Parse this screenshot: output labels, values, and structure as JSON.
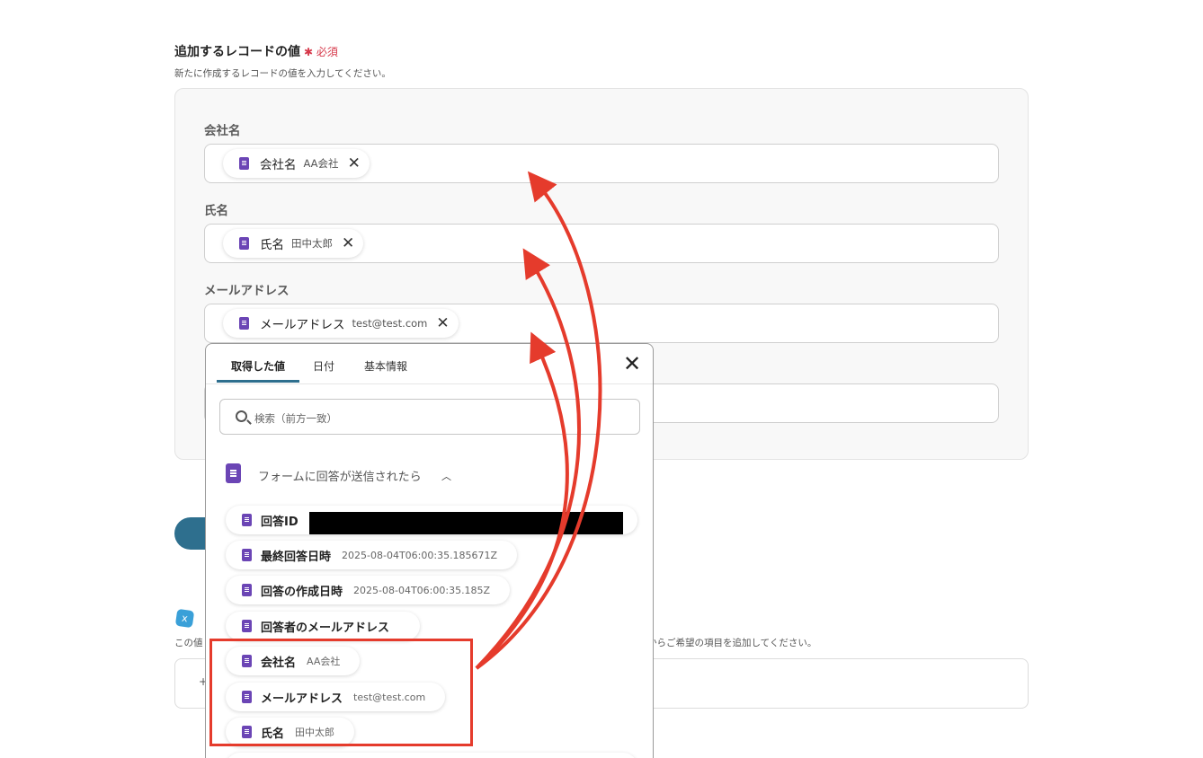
{
  "section": {
    "title": "追加するレコードの値",
    "required_mark": "✱ 必須",
    "description": "新たに作成するレコードの値を入力してください。"
  },
  "fields": [
    {
      "label": "会社名",
      "chip_key": "会社名",
      "chip_value": "AA会社"
    },
    {
      "label": "氏名",
      "chip_key": "氏名",
      "chip_value": "田中太郎"
    },
    {
      "label": "メールアドレス",
      "chip_key": "メールアドレス",
      "chip_value": "test@test.com"
    }
  ],
  "behind": {
    "plus": "+",
    "desc_left": "この値",
    "desc_right": "からご希望の項目を追加してください。"
  },
  "popup": {
    "tabs": [
      "取得した値",
      "日付",
      "基本情報"
    ],
    "active_tab": "取得した値",
    "search_placeholder": "検索（前方一致）",
    "group_title": "フォームに回答が送信されたら",
    "items": [
      {
        "key": "回答ID",
        "value": ""
      },
      {
        "key": "最終回答日時",
        "value": "2025-08-04T06:00:35.185671Z"
      },
      {
        "key": "回答の作成日時",
        "value": "2025-08-04T06:00:35.185Z"
      },
      {
        "key": "回答者のメールアドレス",
        "value": ""
      },
      {
        "key": "会社名",
        "value": "AA会社"
      },
      {
        "key": "メールアドレス",
        "value": "test@test.com"
      },
      {
        "key": "氏名",
        "value": "田中太郎"
      }
    ]
  },
  "colors": {
    "accent": "#2e6f8e",
    "annotation": "#e53b2c",
    "forms_icon": "#6b45b5",
    "required": "#d6384a"
  },
  "icons": [
    "forms-doc-icon",
    "close-icon",
    "search-icon",
    "chevron-up-icon",
    "remove-chip-icon"
  ]
}
